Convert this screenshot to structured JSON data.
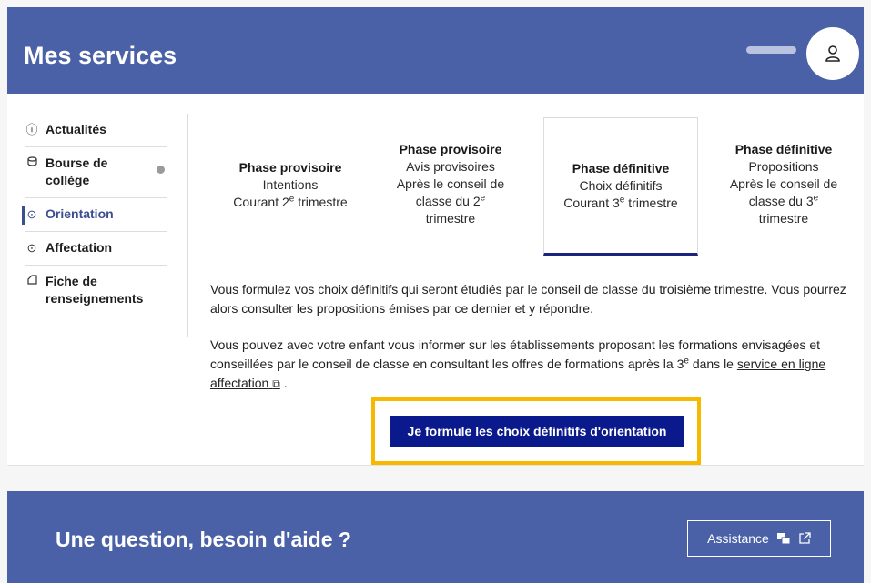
{
  "header": {
    "title": "Mes services"
  },
  "sidebar": {
    "items": [
      {
        "label": "Actualités",
        "icon": "info-icon"
      },
      {
        "label": "Bourse de collège",
        "icon": "coins-icon",
        "badge": true
      },
      {
        "label": "Orientation",
        "icon": "compass-icon",
        "active": true
      },
      {
        "label": "Affectation",
        "icon": "compass-icon"
      },
      {
        "label": "Fiche de renseignements",
        "icon": "edit-icon"
      }
    ]
  },
  "phases": [
    {
      "title": "Phase provisoire",
      "line1": "Intentions",
      "line2": "Courant 2",
      "line2_sup": "e",
      "line2_end": " trimestre"
    },
    {
      "title": "Phase provisoire",
      "line1": "Avis provisoires",
      "line2": "Après le conseil de",
      "line3": "classe du 2",
      "line3_sup": "e",
      "line4": "trimestre"
    },
    {
      "title": "Phase définitive",
      "line1": "Choix définitifs",
      "line2": "Courant 3",
      "line2_sup": "e",
      "line2_end": " trimestre",
      "selected": true
    },
    {
      "title": "Phase définitive",
      "line1": "Propositions",
      "line2": "Après le conseil de",
      "line3": "classe du 3",
      "line3_sup": "e",
      "line4": "trimestre"
    }
  ],
  "content": {
    "para1": "Vous formulez vos choix définitifs qui seront étudiés par le conseil de classe du troisième trimestre. Vous pourrez alors consulter les propositions émises par ce dernier et y répondre.",
    "para2_a": "Vous pouvez avec votre enfant vous informer sur les établissements proposant les formations envisagées et conseillées par le conseil de classe en consultant les offres de formations après la 3",
    "para2_sup": "e",
    "para2_b": " dans le ",
    "link_text": "service en ligne affectation",
    "para2_end": " .",
    "cta_label": "Je formule les choix définitifs d'orientation"
  },
  "footer": {
    "title": "Une question, besoin d'aide ?",
    "assist_label": "Assistance"
  },
  "colors": {
    "brand": "#4a61a7",
    "cta": "#0a1a8c",
    "highlight": "#f7b900",
    "active": "#3b4e8e"
  }
}
